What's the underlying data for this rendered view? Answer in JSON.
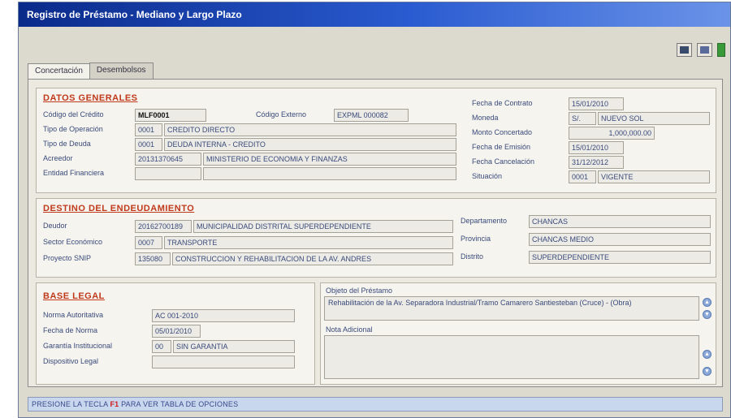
{
  "window": {
    "title": "Registro de Préstamo - Mediano y Largo Plazo"
  },
  "toolbar": {
    "icons": [
      "save-icon",
      "edit-icon",
      "exit-icon"
    ]
  },
  "tabs": [
    {
      "label": "Concertación",
      "active": true
    },
    {
      "label": "Desembolsos",
      "active": false
    }
  ],
  "datos_generales": {
    "title": "DATOS GENERALES",
    "codigo_deuda_label": "Código del Crédito",
    "codigo_deuda_value": "MLF0001",
    "codigo_externo_label": "Código Externo",
    "codigo_externo_value": "EXPML 000082",
    "tipo_operacion_label": "Tipo de Operación",
    "tipo_operacion_code": "0001",
    "tipo_operacion_desc": "CREDITO DIRECTO",
    "tipo_deuda_label": "Tipo de Deuda",
    "tipo_deuda_code": "0001",
    "tipo_deuda_desc": "DEUDA INTERNA - CREDITO",
    "acreedor_label": "Acreedor",
    "acreedor_code": "20131370645",
    "acreedor_desc": "MINISTERIO DE ECONOMIA Y FINANZAS",
    "entidad_label": "Entidad Financiera",
    "entidad_code": "",
    "entidad_desc": ""
  },
  "datos_derecha": {
    "fecha_contrato_label": "Fecha de Contrato",
    "fecha_contrato_value": "15/01/2010",
    "moneda_label": "Moneda",
    "moneda_code": "S/.",
    "moneda_desc": "NUEVO SOL",
    "monto_label": "Monto Concertado",
    "monto_value": "1,000,000.00",
    "fecha_emision_label": "Fecha de Emisión",
    "fecha_emision_value": "15/01/2010",
    "fecha_cancelacion_label": "Fecha Cancelación",
    "fecha_cancelacion_value": "31/12/2012",
    "situacion_label": "Situación",
    "situacion_code": "0001",
    "situacion_desc": "VIGENTE"
  },
  "destino": {
    "title": "DESTINO DEL ENDEUDAMIENTO",
    "deudor_label": "Deudor",
    "deudor_code": "20162700189",
    "deudor_desc": "MUNICIPALIDAD DISTRITAL SUPERDEPENDIENTE",
    "sector_label": "Sector Económico",
    "sector_code": "0007",
    "sector_desc": "TRANSPORTE",
    "proyecto_label": "Proyecto SNIP",
    "proyecto_code": "135080",
    "proyecto_desc": "CONSTRUCCION Y REHABILITACION DE LA AV. ANDRES",
    "departamento_label": "Departamento",
    "departamento_value": "CHANCAS",
    "provincia_label": "Provincia",
    "provincia_value": "CHANCAS MEDIO",
    "distrito_label": "Distrito",
    "distrito_value": "SUPERDEPENDIENTE"
  },
  "base_legal": {
    "title": "BASE LEGAL",
    "norma_label": "Norma Autoritativa",
    "norma_value": "AC 001-2010",
    "fecha_norma_label": "Fecha de Norma",
    "fecha_norma_value": "05/01/2010",
    "garantia_label": "Garantía Institucional",
    "garantia_code": "00",
    "garantia_desc": "SIN GARANTIA",
    "dispositivo_label": "Dispositivo Legal",
    "dispositivo_value": ""
  },
  "objeto": {
    "label": "Objeto del Préstamo",
    "text": "Rehabilitación de la Av. Separadora Industrial/Tramo Camarero Santiesteban (Cruce) - (Obra)"
  },
  "nota": {
    "label": "Nota Adicional",
    "text": ""
  },
  "status": {
    "prefix": "PRESIONE LA TECLA",
    "key": "F1",
    "suffix": "PARA VER TABLA DE OPCIONES"
  }
}
